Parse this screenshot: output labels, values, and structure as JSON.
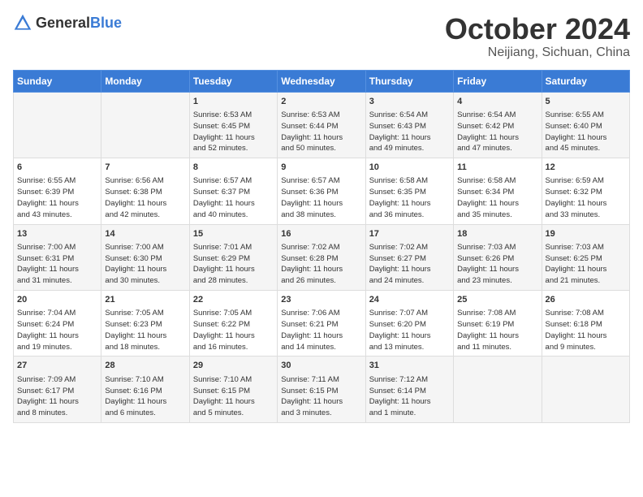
{
  "header": {
    "logo_general": "General",
    "logo_blue": "Blue",
    "title": "October 2024",
    "location": "Neijiang, Sichuan, China"
  },
  "days_of_week": [
    "Sunday",
    "Monday",
    "Tuesday",
    "Wednesday",
    "Thursday",
    "Friday",
    "Saturday"
  ],
  "weeks": [
    [
      {
        "day": "",
        "info": ""
      },
      {
        "day": "",
        "info": ""
      },
      {
        "day": "1",
        "info": "Sunrise: 6:53 AM\nSunset: 6:45 PM\nDaylight: 11 hours\nand 52 minutes."
      },
      {
        "day": "2",
        "info": "Sunrise: 6:53 AM\nSunset: 6:44 PM\nDaylight: 11 hours\nand 50 minutes."
      },
      {
        "day": "3",
        "info": "Sunrise: 6:54 AM\nSunset: 6:43 PM\nDaylight: 11 hours\nand 49 minutes."
      },
      {
        "day": "4",
        "info": "Sunrise: 6:54 AM\nSunset: 6:42 PM\nDaylight: 11 hours\nand 47 minutes."
      },
      {
        "day": "5",
        "info": "Sunrise: 6:55 AM\nSunset: 6:40 PM\nDaylight: 11 hours\nand 45 minutes."
      }
    ],
    [
      {
        "day": "6",
        "info": "Sunrise: 6:55 AM\nSunset: 6:39 PM\nDaylight: 11 hours\nand 43 minutes."
      },
      {
        "day": "7",
        "info": "Sunrise: 6:56 AM\nSunset: 6:38 PM\nDaylight: 11 hours\nand 42 minutes."
      },
      {
        "day": "8",
        "info": "Sunrise: 6:57 AM\nSunset: 6:37 PM\nDaylight: 11 hours\nand 40 minutes."
      },
      {
        "day": "9",
        "info": "Sunrise: 6:57 AM\nSunset: 6:36 PM\nDaylight: 11 hours\nand 38 minutes."
      },
      {
        "day": "10",
        "info": "Sunrise: 6:58 AM\nSunset: 6:35 PM\nDaylight: 11 hours\nand 36 minutes."
      },
      {
        "day": "11",
        "info": "Sunrise: 6:58 AM\nSunset: 6:34 PM\nDaylight: 11 hours\nand 35 minutes."
      },
      {
        "day": "12",
        "info": "Sunrise: 6:59 AM\nSunset: 6:32 PM\nDaylight: 11 hours\nand 33 minutes."
      }
    ],
    [
      {
        "day": "13",
        "info": "Sunrise: 7:00 AM\nSunset: 6:31 PM\nDaylight: 11 hours\nand 31 minutes."
      },
      {
        "day": "14",
        "info": "Sunrise: 7:00 AM\nSunset: 6:30 PM\nDaylight: 11 hours\nand 30 minutes."
      },
      {
        "day": "15",
        "info": "Sunrise: 7:01 AM\nSunset: 6:29 PM\nDaylight: 11 hours\nand 28 minutes."
      },
      {
        "day": "16",
        "info": "Sunrise: 7:02 AM\nSunset: 6:28 PM\nDaylight: 11 hours\nand 26 minutes."
      },
      {
        "day": "17",
        "info": "Sunrise: 7:02 AM\nSunset: 6:27 PM\nDaylight: 11 hours\nand 24 minutes."
      },
      {
        "day": "18",
        "info": "Sunrise: 7:03 AM\nSunset: 6:26 PM\nDaylight: 11 hours\nand 23 minutes."
      },
      {
        "day": "19",
        "info": "Sunrise: 7:03 AM\nSunset: 6:25 PM\nDaylight: 11 hours\nand 21 minutes."
      }
    ],
    [
      {
        "day": "20",
        "info": "Sunrise: 7:04 AM\nSunset: 6:24 PM\nDaylight: 11 hours\nand 19 minutes."
      },
      {
        "day": "21",
        "info": "Sunrise: 7:05 AM\nSunset: 6:23 PM\nDaylight: 11 hours\nand 18 minutes."
      },
      {
        "day": "22",
        "info": "Sunrise: 7:05 AM\nSunset: 6:22 PM\nDaylight: 11 hours\nand 16 minutes."
      },
      {
        "day": "23",
        "info": "Sunrise: 7:06 AM\nSunset: 6:21 PM\nDaylight: 11 hours\nand 14 minutes."
      },
      {
        "day": "24",
        "info": "Sunrise: 7:07 AM\nSunset: 6:20 PM\nDaylight: 11 hours\nand 13 minutes."
      },
      {
        "day": "25",
        "info": "Sunrise: 7:08 AM\nSunset: 6:19 PM\nDaylight: 11 hours\nand 11 minutes."
      },
      {
        "day": "26",
        "info": "Sunrise: 7:08 AM\nSunset: 6:18 PM\nDaylight: 11 hours\nand 9 minutes."
      }
    ],
    [
      {
        "day": "27",
        "info": "Sunrise: 7:09 AM\nSunset: 6:17 PM\nDaylight: 11 hours\nand 8 minutes."
      },
      {
        "day": "28",
        "info": "Sunrise: 7:10 AM\nSunset: 6:16 PM\nDaylight: 11 hours\nand 6 minutes."
      },
      {
        "day": "29",
        "info": "Sunrise: 7:10 AM\nSunset: 6:15 PM\nDaylight: 11 hours\nand 5 minutes."
      },
      {
        "day": "30",
        "info": "Sunrise: 7:11 AM\nSunset: 6:15 PM\nDaylight: 11 hours\nand 3 minutes."
      },
      {
        "day": "31",
        "info": "Sunrise: 7:12 AM\nSunset: 6:14 PM\nDaylight: 11 hours\nand 1 minute."
      },
      {
        "day": "",
        "info": ""
      },
      {
        "day": "",
        "info": ""
      }
    ]
  ]
}
